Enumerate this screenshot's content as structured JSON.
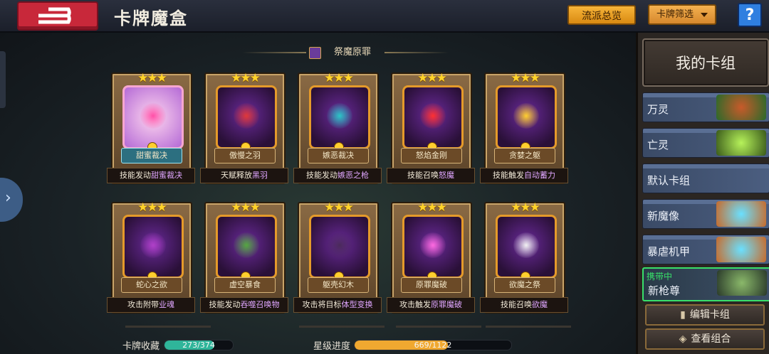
{
  "header": {
    "title": "卡牌魔盒",
    "overview_btn": "流派总览",
    "filter_btn": "卡牌筛选",
    "help_btn": "?"
  },
  "section": {
    "title": "祭魔原罪"
  },
  "cards": [
    {
      "name": "甜蜜裁决",
      "stars": "★★★",
      "skill_pre": "技能发动",
      "skill_hl": "甜蜜裁决",
      "core": "#ff4fa8",
      "theme": "pink"
    },
    {
      "name": "傲慢之羽",
      "stars": "★★★",
      "skill_pre": "天赋释放",
      "skill_hl": "黑羽",
      "core": "#e03838",
      "theme": "orange"
    },
    {
      "name": "嫉恶裁决",
      "stars": "★★★",
      "skill_pre": "技能发动",
      "skill_hl": "嫉恶之枪",
      "core": "#2ac6c6",
      "theme": "orange"
    },
    {
      "name": "怒焰金刚",
      "stars": "★★★",
      "skill_pre": "技能召唤",
      "skill_hl": "怒魔",
      "core": "#ff3030",
      "theme": "orange"
    },
    {
      "name": "贪婪之躯",
      "stars": "★★★",
      "skill_pre": "技能触发",
      "skill_hl": "自动蓄力",
      "core": "#ffcf2e",
      "theme": "orange"
    },
    {
      "name": "蛇心之欲",
      "stars": "★★★",
      "skill_pre": "攻击附带",
      "skill_hl": "业魂",
      "core": "#b040c8",
      "theme": "orange"
    },
    {
      "name": "虚空暴食",
      "stars": "★★★",
      "skill_pre": "技能发动",
      "skill_hl": "吞噬召唤物",
      "core": "#54a840",
      "theme": "orange"
    },
    {
      "name": "躯壳幻木",
      "stars": "★★★",
      "skill_pre": "攻击将目标",
      "skill_hl": "体型变换",
      "core": "#4a2a5a",
      "theme": "orange"
    },
    {
      "name": "原罪魔破",
      "stars": "★★★",
      "skill_pre": "攻击触发",
      "skill_hl": "原罪魔破",
      "core": "#ff6ae0",
      "theme": "orange"
    },
    {
      "name": "欲魔之祭",
      "stars": "★★★",
      "skill_pre": "技能召唤",
      "skill_hl": "欲魔",
      "core": "#f2f2f2",
      "theme": "orange"
    }
  ],
  "sidebar": {
    "title": "我的卡组",
    "decks": [
      {
        "label": "万灵",
        "color": "#6a3a1a"
      },
      {
        "label": "亡灵",
        "color": "#5ab02a"
      },
      {
        "label": "默认卡组",
        "color": ""
      },
      {
        "label": "新魔像",
        "color": "#3a8ad6"
      },
      {
        "label": "暴虐机甲",
        "color": "#3a8ad6"
      },
      {
        "label": "新枪尊",
        "color": "#4a7a5a",
        "tag": "携带中"
      }
    ],
    "edit_btn": "编辑卡组",
    "combo_btn": "查看组合"
  },
  "footer": {
    "collection_label": "卡牌收藏",
    "collection_value": "273/374",
    "collection_fraction": 0.73,
    "star_label": "星级进度",
    "star_value": "669/1122",
    "star_fraction": 0.596
  },
  "colors": {
    "accent": "#f7b53a",
    "back": "#c8283a",
    "help": "#2f7fe0",
    "active_deck": "#38e06a",
    "collection_fill": "#2fb59a",
    "star_fill": "#f0a830"
  }
}
